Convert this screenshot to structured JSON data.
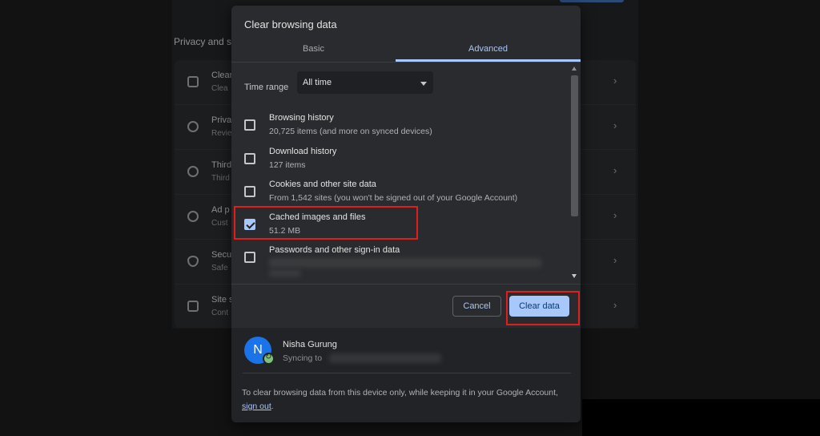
{
  "background": {
    "section_heading": "Privacy and s",
    "rows": [
      {
        "t1": "Clear",
        "t2": "Clea",
        "icon": "trash-icon"
      },
      {
        "t1": "Priva",
        "t2": "Revie",
        "icon": "plus-circle-icon"
      },
      {
        "t1": "Third",
        "t2": "Third",
        "icon": "cookie-icon"
      },
      {
        "t1": "Ad p",
        "t2": "Cust",
        "icon": "ad-privacy-icon"
      },
      {
        "t1": "Secu",
        "t2": "Safe",
        "icon": "shield-icon"
      },
      {
        "t1": "Site s",
        "t2": "Cont",
        "icon": "sliders-icon"
      }
    ]
  },
  "dialog": {
    "title": "Clear browsing data",
    "tabs": [
      {
        "label": "Basic",
        "active": false
      },
      {
        "label": "Advanced",
        "active": true
      }
    ],
    "time_range": {
      "label": "Time range",
      "value": "All time"
    },
    "items": [
      {
        "title": "Browsing history",
        "subtitle": "20,725 items (and more on synced devices)",
        "checked": false
      },
      {
        "title": "Download history",
        "subtitle": "127 items",
        "checked": false
      },
      {
        "title": "Cookies and other site data",
        "subtitle": "From 1,542 sites (you won't be signed out of your Google Account)",
        "checked": false
      },
      {
        "title": "Cached images and files",
        "subtitle": "51.2 MB",
        "checked": true
      },
      {
        "title": "Passwords and other sign-in data",
        "subtitle": "",
        "checked": false
      }
    ],
    "buttons": {
      "cancel": "Cancel",
      "clear": "Clear data"
    },
    "account": {
      "avatar_letter": "N",
      "name": "Nisha Gurung",
      "sync_text": "Syncing to"
    },
    "note": {
      "text": "To clear browsing data from this device only, while keeping it in your Google Account,",
      "link": "sign out",
      "end": "."
    }
  },
  "colors": {
    "accent": "#a8c7fa",
    "highlight": "#e01e1e",
    "dialog_bg": "#2a2b2e"
  }
}
